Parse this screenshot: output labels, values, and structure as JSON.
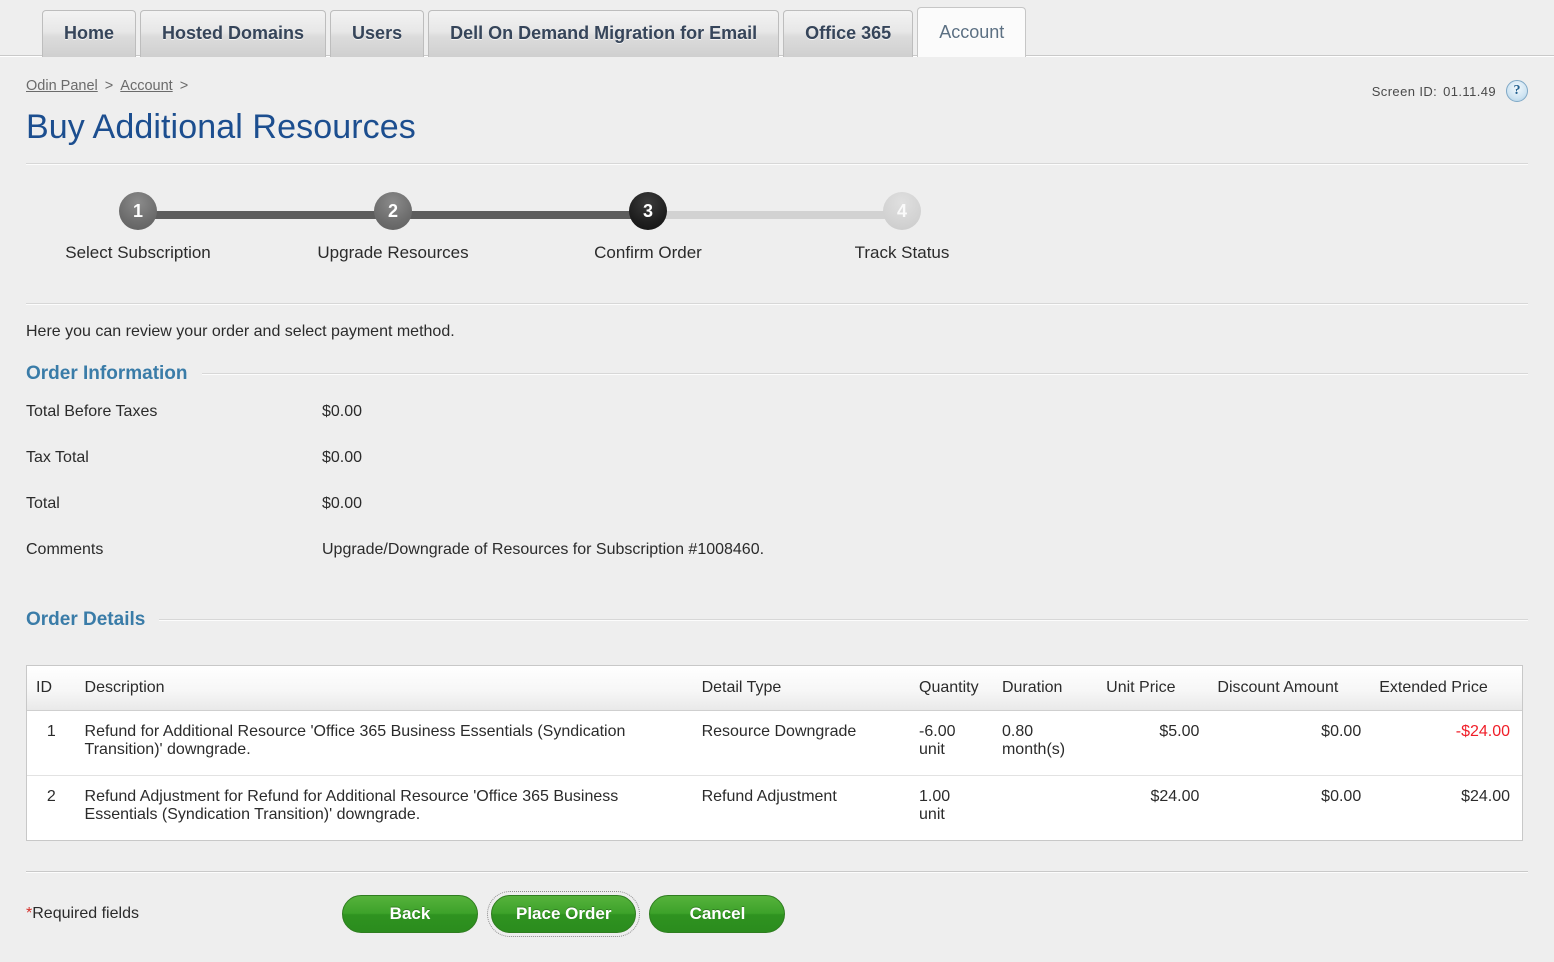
{
  "tabs": [
    {
      "label": "Home",
      "active": false
    },
    {
      "label": "Hosted Domains",
      "active": false
    },
    {
      "label": "Users",
      "active": false
    },
    {
      "label": "Dell On Demand Migration for Email",
      "active": false
    },
    {
      "label": "Office 365",
      "active": false
    },
    {
      "label": "Account",
      "active": true
    }
  ],
  "breadcrumb": {
    "items": [
      "Odin Panel",
      "Account"
    ],
    "separator": ">",
    "trailing": ">"
  },
  "header": {
    "screen_id_label": "Screen ID:",
    "screen_id_value": "01.11.49",
    "help_icon": "question-mark-icon",
    "title": "Buy Additional Resources"
  },
  "wizard": {
    "steps": [
      {
        "number": "1",
        "label": "Select Subscription",
        "state": "done"
      },
      {
        "number": "2",
        "label": "Upgrade Resources",
        "state": "done"
      },
      {
        "number": "3",
        "label": "Confirm Order",
        "state": "current"
      },
      {
        "number": "4",
        "label": "Track Status",
        "state": "todo"
      }
    ]
  },
  "intro": "Here you can review your order and select payment method.",
  "order_information": {
    "heading": "Order Information",
    "rows": [
      {
        "label": "Total Before Taxes",
        "value": "$0.00"
      },
      {
        "label": "Tax Total",
        "value": "$0.00"
      },
      {
        "label": "Total",
        "value": "$0.00"
      },
      {
        "label": "Comments",
        "value": "Upgrade/Downgrade of Resources for Subscription #1008460."
      }
    ]
  },
  "order_details": {
    "heading": "Order Details",
    "columns": [
      "ID",
      "Description",
      "Detail Type",
      "Quantity",
      "Duration",
      "Unit Price",
      "Discount Amount",
      "Extended Price"
    ],
    "rows": [
      {
        "id": "1",
        "description": "Refund for Additional Resource 'Office 365 Business Essentials (Syndication Transition)' downgrade.",
        "detail_type": "Resource Downgrade",
        "quantity": "-6.00",
        "quantity_unit": "unit",
        "duration": "0.80",
        "duration_unit": "month(s)",
        "unit_price": "$5.00",
        "discount_amount": "$0.00",
        "extended_price": "-$24.00",
        "extended_price_negative": true
      },
      {
        "id": "2",
        "description": "Refund Adjustment for Refund for Additional Resource 'Office 365 Business Essentials (Syndication Transition)' downgrade.",
        "detail_type": "Refund Adjustment",
        "quantity": "1.00",
        "quantity_unit": "unit",
        "duration": "",
        "duration_unit": "",
        "unit_price": "$24.00",
        "discount_amount": "$0.00",
        "extended_price": "$24.00",
        "extended_price_negative": false
      }
    ]
  },
  "footer": {
    "required_star": "*",
    "required_text": "Required fields",
    "buttons": [
      {
        "label": "Back",
        "focused": false
      },
      {
        "label": "Place Order",
        "focused": true
      },
      {
        "label": "Cancel",
        "focused": false
      }
    ]
  },
  "colors": {
    "page_bg": "#eeeeee",
    "title_blue": "#1c4e8f",
    "section_blue": "#3a7ca8",
    "button_green": "#3da22a",
    "negative_red": "#f01e28",
    "required_red": "#d4302a",
    "step_current": "#111111",
    "step_done": "#6d6d6d",
    "step_todo": "#c9c9c9"
  }
}
